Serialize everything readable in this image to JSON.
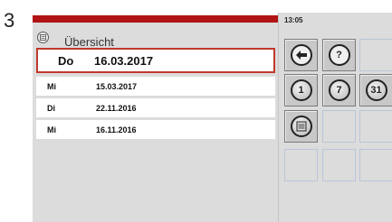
{
  "step_number": "3",
  "header": {
    "title": "Übersicht",
    "icon": "overview-icon"
  },
  "rows": [
    {
      "day": "Do",
      "date": "16.03.2017",
      "selected": true
    },
    {
      "day": "Mi",
      "date": "15.03.2017",
      "selected": false
    },
    {
      "day": "Di",
      "date": "22.11.2016",
      "selected": false
    },
    {
      "day": "Mi",
      "date": "16.11.2016",
      "selected": false
    }
  ],
  "status": {
    "time": "13:05"
  },
  "buttons": {
    "back": {
      "icon": "arrow-left-icon"
    },
    "help": {
      "label": "?"
    },
    "day_view": {
      "label": "1"
    },
    "week_view": {
      "label": "7"
    },
    "month_view": {
      "label": "31"
    },
    "list_view": {
      "icon": "list-icon"
    }
  },
  "colors": {
    "accent_red": "#b01414",
    "selected_border": "#c0392b",
    "panel_bg": "#dcdcdc"
  }
}
